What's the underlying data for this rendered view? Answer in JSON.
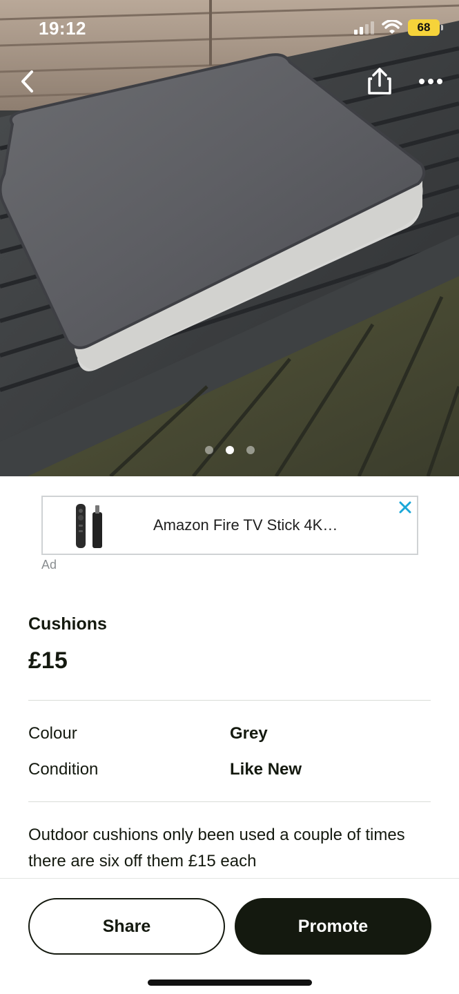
{
  "status_bar": {
    "time": "19:12",
    "battery": "68",
    "icons": [
      "signal-icon",
      "wifi-icon",
      "battery-icon"
    ]
  },
  "hero": {
    "image": "grey-cushion-on-garden-bench-photo",
    "nav": [
      "back-icon",
      "share-icon",
      "more-icon"
    ],
    "pagination": {
      "count": 3,
      "active_index": 1
    }
  },
  "ad": {
    "title": "Amazon Fire TV Stick 4K…",
    "label": "Ad",
    "close_icon": "close-icon"
  },
  "listing": {
    "title": "Cushions",
    "price": "£15",
    "attributes": [
      {
        "label": "Colour",
        "value": "Grey"
      },
      {
        "label": "Condition",
        "value": "Like New"
      }
    ],
    "description": "Outdoor cushions only been used a couple of times there are six off them £15 each"
  },
  "actions": {
    "share_label": "Share",
    "promote_label": "Promote"
  },
  "colors": {
    "primary_dark": "#14190f",
    "ad_close": "#1aa7d8",
    "battery": "#f6d33a"
  }
}
